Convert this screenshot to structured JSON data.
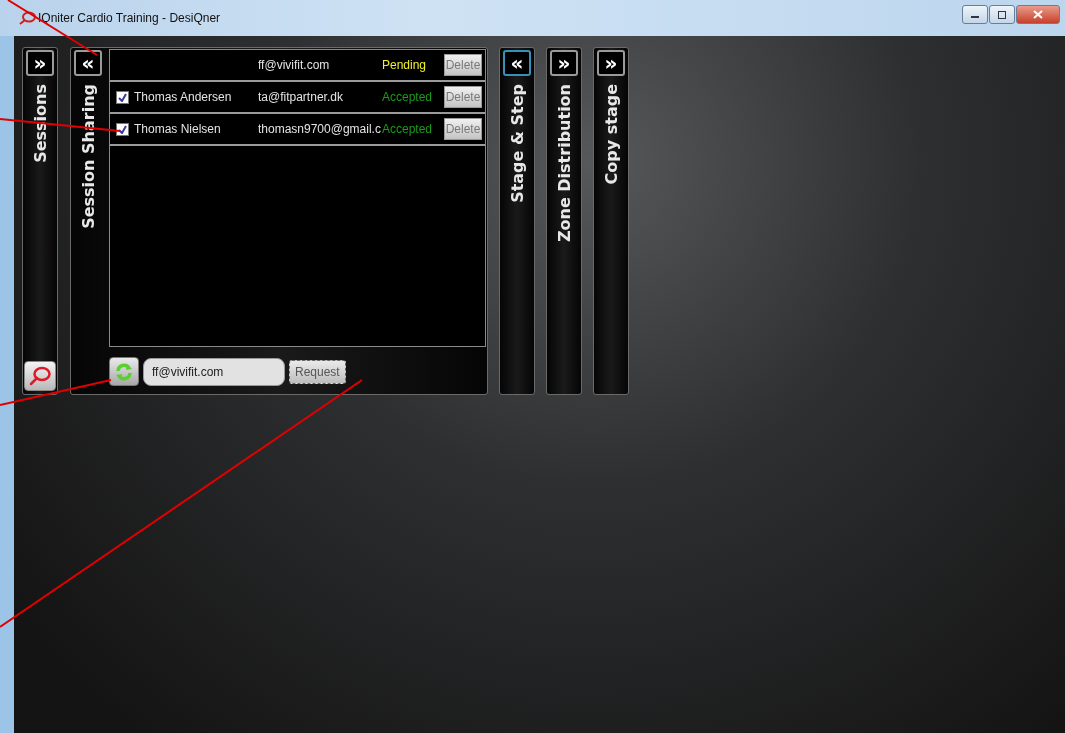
{
  "window": {
    "title": "IQniter Cardio Training - DesiQner"
  },
  "panels": [
    {
      "kind": "collapsed",
      "label": "Sessions",
      "toggle": "»",
      "focused": false
    },
    {
      "kind": "sharing",
      "label": "Session Sharing",
      "toggle": "«",
      "focused": false
    },
    {
      "kind": "collapsed",
      "label": "Stage & Step",
      "toggle": "«",
      "focused": true
    },
    {
      "kind": "collapsed",
      "label": "Zone Distribution",
      "toggle": "»",
      "focused": false
    },
    {
      "kind": "collapsed",
      "label": "Copy stage",
      "toggle": "»",
      "focused": false
    }
  ],
  "sharing": {
    "rows": [
      {
        "kind": "pending",
        "name": "",
        "email": "ff@vivifit.com",
        "status": "Pending",
        "action": "Delete"
      },
      {
        "kind": "accepted",
        "checked": true,
        "name": "Thomas Andersen",
        "email": "ta@fitpartner.dk",
        "status": "Accepted",
        "action": "Delete"
      },
      {
        "kind": "accepted",
        "checked": true,
        "name": "Thomas Nielsen",
        "email": "thomasn9700@gmail.c",
        "status": "Accepted",
        "action": "Delete"
      }
    ],
    "request_field": {
      "value": "ff@vivifit.com"
    },
    "request_button": "Request"
  }
}
